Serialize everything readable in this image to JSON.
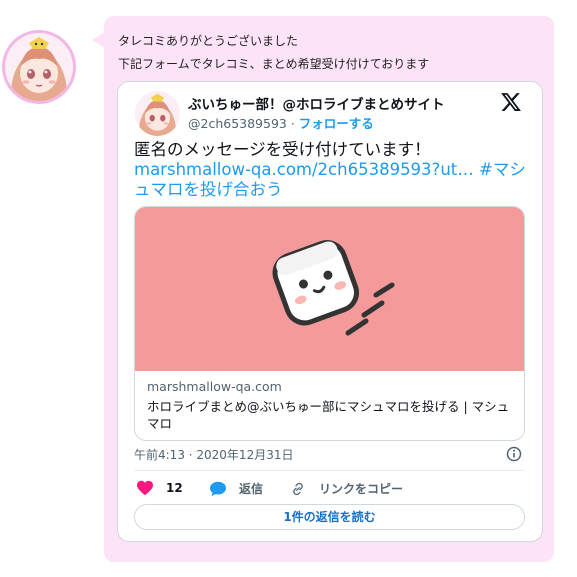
{
  "message": {
    "line1": "タレコミありがとうございました",
    "line2": "下記フォームでタレコミ、まとめ希望受け付けております"
  },
  "tweet": {
    "author_name": "ぶいちゅー部！@ホロライブまとめサイト",
    "handle": "@2ch65389593",
    "separator": " · ",
    "follow_label": "フォローする",
    "text": "匿名のメッセージを受け付けています！",
    "link_url": "marshmallow-qa.com/2ch65389593?ut…",
    "hashtag": "#マシュマロを投げ合おう",
    "card": {
      "domain": "marshmallow-qa.com",
      "title": "ホロライブまとめ@ぶいちゅー部にマシュマロを投げる | マシュマロ"
    },
    "timestamp": "午前4:13 · 2020年12月31日",
    "like_count": "12",
    "reply_label": "返信",
    "copy_link_label": "リンクをコピー",
    "read_replies_label": "1件の返信を読む"
  },
  "icons": {
    "x_logo": "x-logo-icon",
    "info": "info-icon",
    "heart": "heart-icon",
    "reply": "speech-bubble-icon",
    "link": "link-icon"
  },
  "colors": {
    "bubble": "#fde3f7",
    "accent": "#1d9bf0",
    "heart": "#f91880",
    "preview_bg": "#f49a9b"
  }
}
